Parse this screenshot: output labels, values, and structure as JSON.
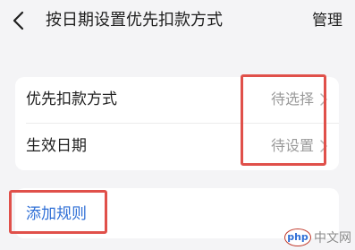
{
  "header": {
    "title": "按日期设置优先扣款方式",
    "back_icon": "chevron-left-icon",
    "manage_label": "管理"
  },
  "settings": {
    "rows": [
      {
        "label": "优先扣款方式",
        "value": "待选择",
        "icon": "chevron-right-icon"
      },
      {
        "label": "生效日期",
        "value": "待设置",
        "icon": "chevron-right-icon"
      }
    ]
  },
  "rules": {
    "add_label": "添加规则"
  },
  "watermark": {
    "logo_text": "php",
    "text": "中文网"
  },
  "colors": {
    "background": "#f4f4f6",
    "card": "#ffffff",
    "link": "#2f6fd6",
    "highlight": "#e0504a",
    "muted": "#9a9a9a"
  }
}
